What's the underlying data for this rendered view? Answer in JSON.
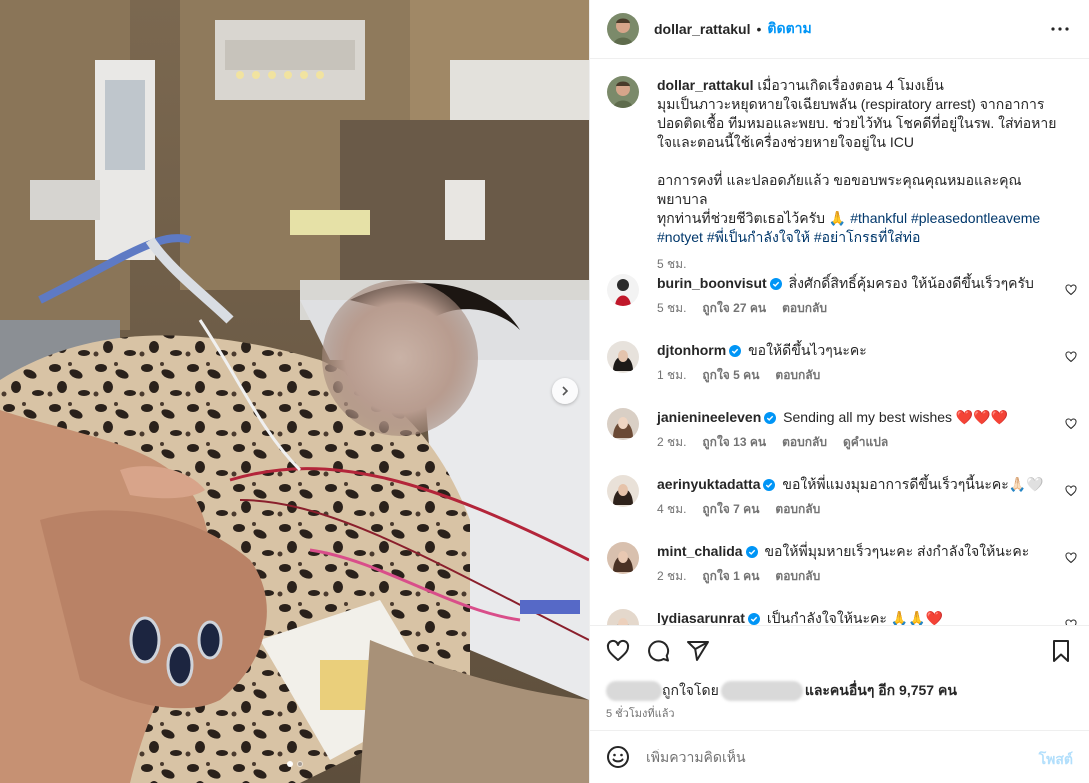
{
  "media": {
    "next_icon": "chevron-right-icon",
    "slides_total": 2,
    "slide_active": 1
  },
  "header": {
    "username": "dollar_rattakul",
    "separator": "•",
    "follow_label": "ติดตาม",
    "more_icon": "ellipsis-icon"
  },
  "caption": {
    "username": "dollar_rattakul",
    "line1": "เมื่อวานเกิดเรื่องตอน 4 โมงเย็น",
    "line2": "มุมเป็นภาวะหยุดหายใจเฉียบพลัน (respiratory arrest) จากอาการ",
    "line3": "ปอดติดเชื้อ ทีมหมอและพยบ. ช่วยไว้ทัน โชคดีที่อยู่ในรพ. ใส่ท่อหาย",
    "line4": "ใจและตอนนี้ใช้เครื่องช่วยหายใจอยู่ใน ICU",
    "line5": "อาการคงที่ และปลอดภัยแล้ว ขอขอบพระคุณคุณหมอและคุณพยาบาล",
    "line6_text": "ทุกท่านที่ช่วยชีวิตเธอไว้ครับ 🙏",
    "tag_thankful": "#thankful",
    "tag_pleasedontleaveme": "#pleasedontleaveme",
    "tag_notyet": "#notyet",
    "tag_thai1": "#พี่เป็นกำลังใจให้",
    "tag_thai2": "#อย่าโกรธที่ใส่ท่อ",
    "time": "5 ชม."
  },
  "comments": [
    {
      "username": "burin_boonvisut",
      "verified": true,
      "text": "สิ่งศักดิ์สิทธิ์คุ้มครอง ให้น้องดีขึ้นเร็วๆครับ",
      "time": "5 ชม.",
      "likes": "ถูกใจ 27 คน",
      "reply": "ตอบกลับ",
      "translate": ""
    },
    {
      "username": "djtonhorm",
      "verified": true,
      "text": "ขอให้ดีขึ้นไวๆนะคะ",
      "time": "1 ชม.",
      "likes": "ถูกใจ 5 คน",
      "reply": "ตอบกลับ",
      "translate": ""
    },
    {
      "username": "janienineeleven",
      "verified": true,
      "text": "Sending all my best wishes ❤️❤️❤️",
      "time": "2 ชม.",
      "likes": "ถูกใจ 13 คน",
      "reply": "ตอบกลับ",
      "translate": "ดูคำแปล"
    },
    {
      "username": "aerinyuktadatta",
      "verified": true,
      "text": "ขอให้พี่แมงมุมอาการดีขึ้นเร็วๆนี้นะคะ🙏🏻🤍",
      "time": "4 ชม.",
      "likes": "ถูกใจ 7 คน",
      "reply": "ตอบกลับ",
      "translate": ""
    },
    {
      "username": "mint_chalida",
      "verified": true,
      "text": "ขอให้พี่มุมหายเร็วๆนะคะ ส่งกำลังใจให้นะคะ",
      "time": "2 ชม.",
      "likes": "ถูกใจ 1 คน",
      "reply": "ตอบกลับ",
      "translate": ""
    },
    {
      "username": "lydiasarunrat",
      "verified": true,
      "text": "เป็นกำลังใจให้นะคะ 🙏🙏❤️",
      "time": "",
      "likes": "",
      "reply": "",
      "translate": ""
    }
  ],
  "actions": {
    "like_icon": "heart-icon",
    "comment_icon": "comment-icon",
    "share_icon": "share-icon",
    "save_icon": "bookmark-icon",
    "likes_prefix": "ถูกใจโดย",
    "likes_suffix": "และคนอื่นๆ อีก 9,757 คน",
    "time_ago": "5 ชั่วโมงที่แล้ว"
  },
  "add_comment": {
    "emoji_icon": "emoji-icon",
    "placeholder": "เพิ่มความคิดเห็น",
    "post_label": "โพสต์"
  },
  "colors": {
    "accent": "#0095f6",
    "link": "#00376b",
    "muted": "#737373",
    "post_disabled": "#b2dffc",
    "heart_red": "#ff3040"
  }
}
